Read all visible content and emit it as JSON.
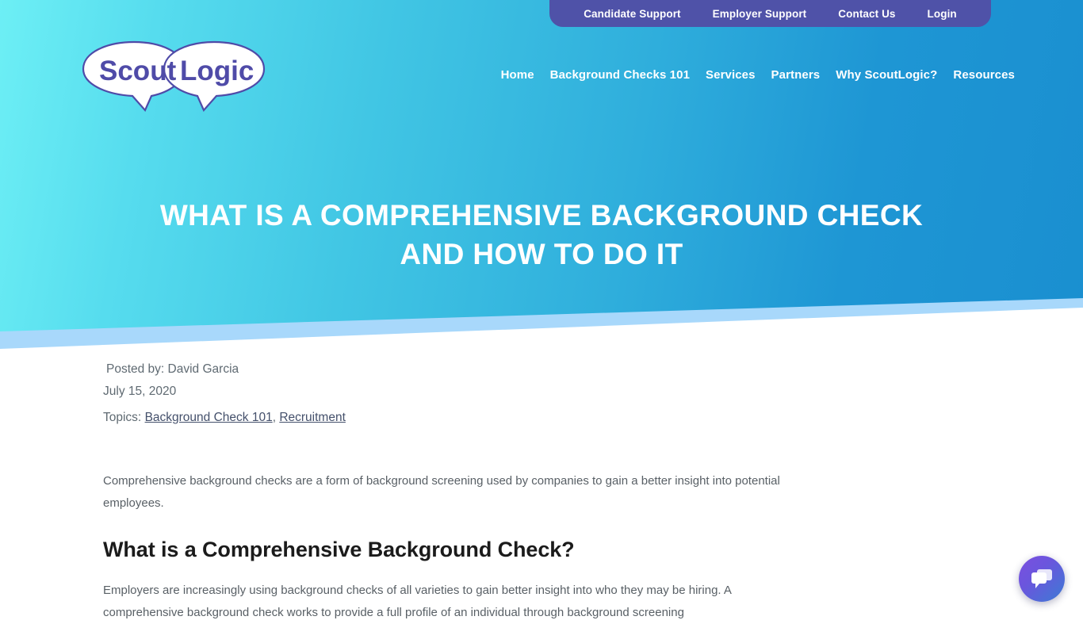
{
  "utility_bar": {
    "links": [
      {
        "label": "Candidate Support"
      },
      {
        "label": "Employer Support"
      },
      {
        "label": "Contact Us"
      },
      {
        "label": "Login"
      }
    ],
    "background_color": "#4F52A8"
  },
  "logo": {
    "text_left": "Scout",
    "text_right": "Logic",
    "text_color": "#4F4BA8",
    "bubble_fill": "#FFFFFF"
  },
  "main_nav": {
    "links": [
      {
        "label": "Home"
      },
      {
        "label": "Background Checks 101"
      },
      {
        "label": "Services"
      },
      {
        "label": "Partners"
      },
      {
        "label": "Why ScoutLogic?"
      },
      {
        "label": "Resources"
      }
    ]
  },
  "hero": {
    "title_line1": "WHAT IS A COMPREHENSIVE BACKGROUND CHECK",
    "title_line2": "AND HOW TO DO IT",
    "gradient_start": "#6DEFF5",
    "gradient_end": "#1A8FD0",
    "band_color": "#A8D8FB"
  },
  "article": {
    "author": "Posted by: David Garcia",
    "date": "July 15, 2020",
    "topics_label": "Topics:",
    "topics": [
      {
        "label": "Background Check 101"
      },
      {
        "label": "Recruitment"
      }
    ],
    "topics_separator": ", ",
    "intro_paragraph": "Comprehensive background checks are a form of background screening used by companies to gain a better insight into potential employees.",
    "section_heading": "What is a Comprehensive Background Check?",
    "second_paragraph": "Employers are increasingly using background checks of all varieties to gain better insight into who they may be hiring. A comprehensive background check works to provide a full profile of an individual through background screening"
  },
  "chat_widget": {
    "icon": "chat-bubbles-icon",
    "gradient_start": "#7B4FE0",
    "gradient_end": "#3C7BD4"
  }
}
